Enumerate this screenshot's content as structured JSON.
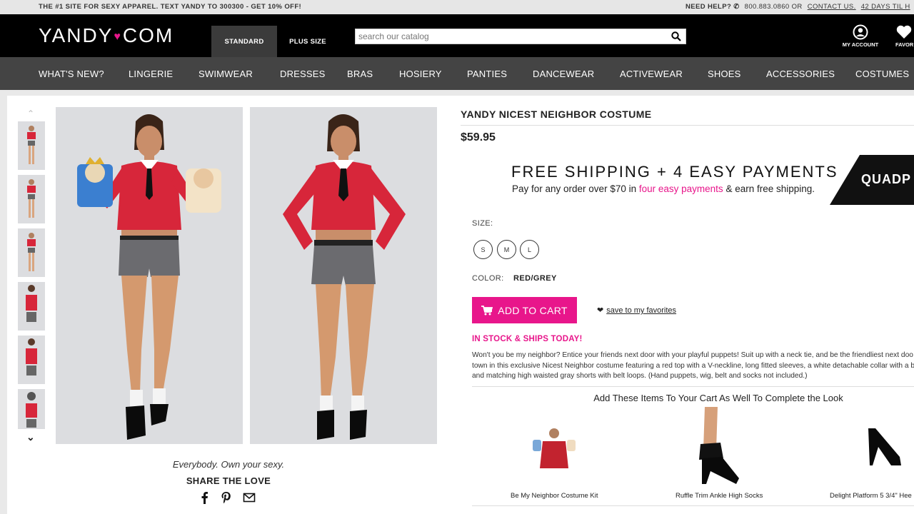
{
  "topbar": {
    "promo": "THE #1 SITE FOR SEXY APPAREL. TEXT YANDY TO 300300 - GET 10% OFF!",
    "need_help": "NEED HELP?",
    "phone": "800.883.0860 OR",
    "contact": "CONTACT US.",
    "returns": "42 DAYS TIL H"
  },
  "header": {
    "logo_left": "YANDY",
    "logo_right": "COM",
    "tabs": [
      "STANDARD",
      "PLUS SIZE"
    ],
    "search_placeholder": "search our catalog",
    "account": "MY ACCOUNT",
    "favorites": "FAVOR"
  },
  "nav": [
    "WHAT'S NEW?",
    "LINGERIE",
    "SWIMWEAR",
    "DRESSES",
    "BRAS",
    "HOSIERY",
    "PANTIES",
    "DANCEWEAR",
    "ACTIVEWEAR",
    "SHOES",
    "ACCESSORIES",
    "COSTUMES"
  ],
  "gallery": {
    "tagline": "Everybody. Own your sexy.",
    "share": "SHARE THE LOVE"
  },
  "product": {
    "title": "YANDY NICEST NEIGHBOR COSTUME",
    "price": "$59.95",
    "shipping_headline": "FREE SHIPPING + 4 EASY PAYMENTS",
    "shipping_pre": "Pay for any order over $70 in",
    "shipping_link": "four easy payments",
    "shipping_post": "& earn free shipping.",
    "quad_badge": "QUADP",
    "size_label": "SIZE:",
    "sizes": [
      "S",
      "M",
      "L"
    ],
    "color_label": "COLOR:",
    "color_value": "RED/GREY",
    "add_to_cart": "ADD TO CART",
    "save_favorites": "save to my favorites",
    "stock": "IN STOCK & SHIPS TODAY!",
    "description_lines": [
      "Won't you be my neighbor? Entice your friends next door with your playful puppets! Suit up with a neck tie, and be the friendliest next doo",
      "town in this exclusive Nicest Neighbor costume featuring a red top with a V-neckline, long fitted sleeves, a white detachable collar with a b",
      "and matching high waisted gray shorts with belt loops. (Hand puppets, wig, belt and socks not included.)"
    ]
  },
  "complete_look": {
    "heading": "Add These Items To Your Cart As Well To Complete the Look",
    "items": [
      "Be My Neighbor Costume Kit",
      "Ruffle Trim Ankle High Socks",
      "Delight Platform 5 3/4\" Hee"
    ]
  },
  "colors": {
    "accent": "#e8168b",
    "header": "#000000",
    "nav": "#444444"
  }
}
